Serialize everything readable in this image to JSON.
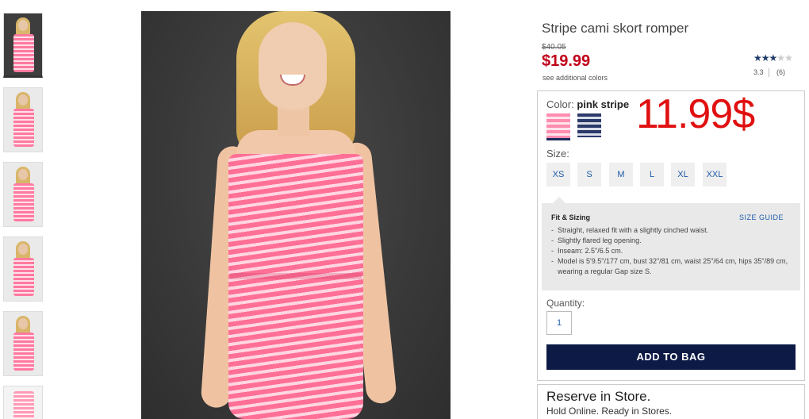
{
  "product": {
    "title": "Stripe cami skort romper",
    "old_price": "$40.05",
    "price": "$19.99",
    "see_colors": "see additional colors",
    "rating_value": "3.3",
    "review_count": "(6)",
    "stars_filled": 3,
    "stars_total": 5
  },
  "color": {
    "label": "Color:",
    "selected": "pink stripe",
    "swatches": [
      "pink stripe",
      "navy stripe"
    ]
  },
  "promo_overlay": "11.99$",
  "size": {
    "label": "Size:",
    "options": [
      "XS",
      "S",
      "M",
      "L",
      "XL",
      "XXL"
    ]
  },
  "fit": {
    "title": "Fit & Sizing",
    "size_guide": "SIZE GUIDE",
    "items": [
      "Straight, relaxed fit with a slightly cinched waist.",
      "Slightly flared leg opening.",
      "Inseam: 2.5\"/6.5 cm.",
      "Model is 5'9.5\"/177 cm, bust 32\"/81 cm, waist 25\"/64 cm, hips 35\"/89 cm, wearing a regular Gap size S."
    ]
  },
  "quantity": {
    "label": "Quantity:",
    "value": "1"
  },
  "add_to_bag": "ADD TO BAG",
  "reserve": {
    "title": "Reserve in Store.",
    "subtitle": "Hold Online. Ready in Stores."
  },
  "colors": {
    "price_red": "#c0001a",
    "promo_red": "#e01010",
    "navy": "#0c1a45",
    "link_blue": "#1d5aa8"
  }
}
